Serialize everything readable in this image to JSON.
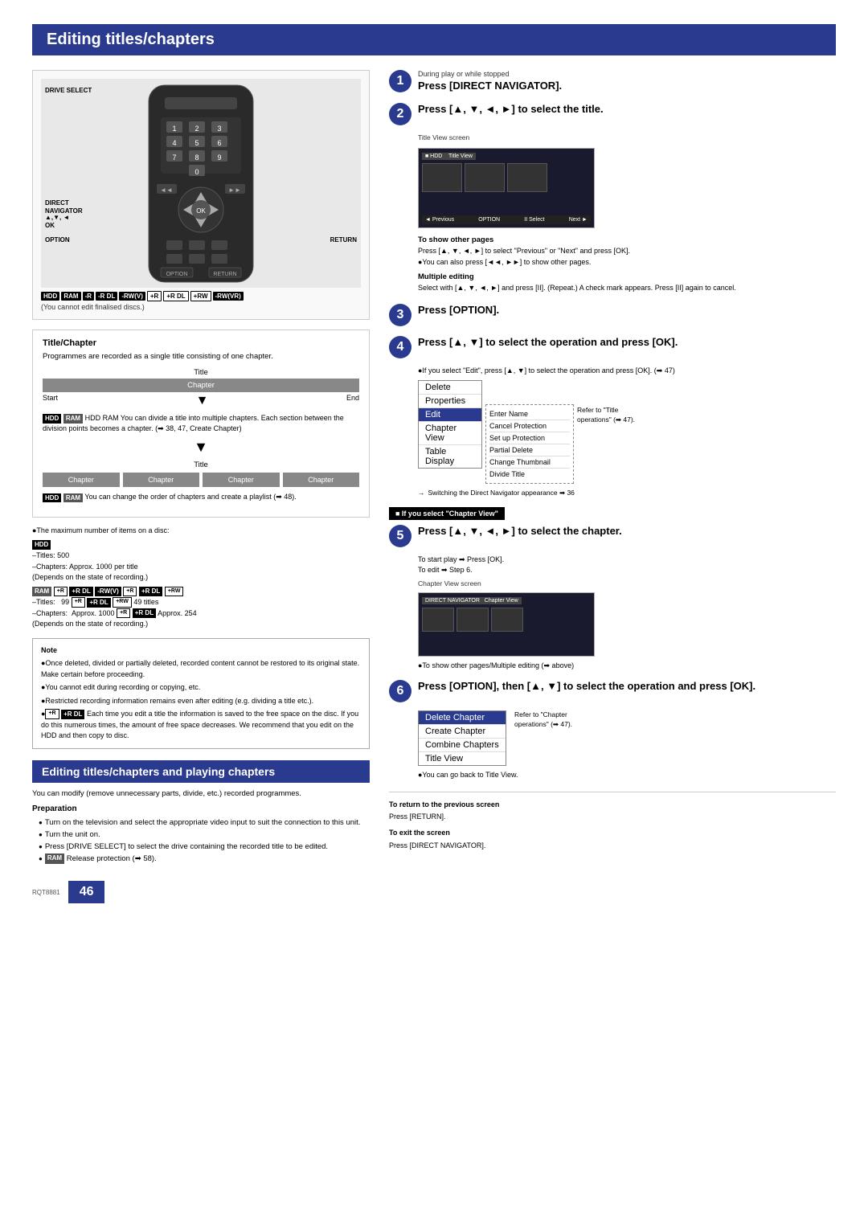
{
  "page": {
    "title": "Editing titles/chapters",
    "page_number": "46",
    "rqt_label": "RQT8881"
  },
  "left_col": {
    "remote_labels": {
      "drive_select": "DRIVE SELECT",
      "direct_navigator": "DIRECT\nNAVIGATOR",
      "arrows": "▲,▼, ◄\nOK",
      "option": "OPTION",
      "return": "RETURN"
    },
    "disc_badges": [
      "HDD",
      "RAM",
      "-R",
      "-R DL",
      "-RW(V)",
      "+R",
      "+R DL",
      "+RW",
      "-RW(VR)"
    ],
    "cant_edit": "(You cannot edit finalised discs.)",
    "title_chapter_section": {
      "title": "Title/Chapter",
      "desc": "Programmes are recorded as a single title consisting of one chapter.",
      "diagram": {
        "title_label": "Title",
        "chapter_label": "Chapter",
        "start_label": "Start",
        "end_label": "End",
        "hdd_ram_note": "HDD RAM You can divide a title into multiple chapters. Each section between the division points becomes a chapter. (➡ 38, 47, Create Chapter)"
      },
      "chapters_diagram": {
        "title_label": "Title",
        "chapters": [
          "Chapter",
          "Chapter",
          "Chapter",
          "Chapter"
        ],
        "hdd_ram_note": "HDD RAM You can change the order of chapters and create a playlist (➡ 48)."
      }
    },
    "max_items": {
      "intro": "●The maximum number of items on a disc:",
      "hdd_label": "HDD",
      "hdd_titles": "–Titles:   500",
      "hdd_chapters": "–Chapters:  Approx. 1000 per title",
      "hdd_depends": "(Depends on the state of recording.)",
      "ram_label": "RAM +R  +R DL  -RW(V)  +R  +R DL  +RW",
      "ram_titles": "–Titles:   99 +R +R DL +RW 49 titles",
      "ram_chapters": "–Chapters:  Approx. 1000 +R +R DL Approx. 254",
      "ram_depends": "(Depends on the state of recording.)"
    },
    "note": {
      "label": "Note",
      "items": [
        "Once deleted, divided or partially deleted, recorded content cannot be restored to its original state. Make certain before proceeding.",
        "You cannot edit during recording or copying, etc.",
        "Restricted recording information remains even after editing (e.g. dividing a title etc.).",
        "+R +R DL Each time you edit a title the information is saved to the free space on the disc. If you do this numerous times, the amount of free space decreases. We recommend that you edit on the HDD and then copy to disc."
      ]
    }
  },
  "editing_playing": {
    "title": "Editing titles/chapters and playing chapters",
    "desc": "You can modify (remove unnecessary parts, divide, etc.) recorded programmes.",
    "preparation": {
      "label": "Preparation",
      "items": [
        "Turn on the television and select the appropriate video input to suit the connection to this unit.",
        "Turn the unit on.",
        "Press [DRIVE SELECT] to select the drive containing the recorded title to be edited.",
        "RAM Release protection (➡ 58)."
      ]
    }
  },
  "right_col": {
    "steps": [
      {
        "number": "1",
        "sub": "During play or while stopped",
        "heading": "Press [DIRECT NAVIGATOR]."
      },
      {
        "number": "2",
        "heading": "Press [▲, ▼, ◄, ►] to select the title.",
        "screen_label": "Title View screen",
        "screen_note": "Title View screen",
        "to_show_pages_label": "To show other pages",
        "to_show_desc": "Press [▲, ▼, ◄, ►] to select \"Previous\" or \"Next\" and press [OK].",
        "also_press": "●You can also press [◄◄, ►►] to show other pages.",
        "multiple_editing_label": "Multiple editing",
        "multiple_editing_desc": "Select with [▲, ▼, ◄, ►] and press [II]. (Repeat.) A check mark appears. Press [II] again to cancel."
      },
      {
        "number": "3",
        "heading": "Press [OPTION]."
      },
      {
        "number": "4",
        "heading": "Press [▲, ▼] to select the operation and press [OK].",
        "bullet": "●If you select \"Edit\", press [▲, ▼] to select the operation and press [OK]. (➡ 47)",
        "menu_items": [
          "Enter Name",
          "Cancel Protection",
          "Set up Protection",
          "Partial Delete",
          "Change Thumbnail",
          "Divide Title"
        ],
        "menu_left": [
          "Delete",
          "Properties",
          "Edit"
        ],
        "menu_bottom": [
          "Chapter View",
          "Table Display"
        ],
        "refer_text": "Refer to \"Title operations\" (➡ 47).",
        "switching_text": "Switching the Direct Navigator appearance ➡ 36"
      },
      {
        "number": "5",
        "if_select_label": "■ If you select \"Chapter View\"",
        "heading": "Press [▲, ▼, ◄, ►] to select the chapter.",
        "to_start_play": "To start play ➡ Press [OK].",
        "to_edit": "To edit ➡ Step 6.",
        "screen_label": "Chapter View screen",
        "show_other": "●To show other pages/Multiple editing (➡ above)"
      },
      {
        "number": "6",
        "heading": "Press [OPTION], then [▲, ▼] to select the operation and press [OK].",
        "chapter_menu_items": [
          "Delete Chapter",
          "Create Chapter",
          "Combine Chapters",
          "Title View"
        ],
        "refer_text": "Refer to \"Chapter operations\" (➡ 47).",
        "go_back": "●You can go back to Title View."
      }
    ],
    "bottom_nav": {
      "return_label": "To return to the previous screen",
      "return_action": "Press [RETURN].",
      "exit_label": "To exit the screen",
      "exit_action": "Press [DIRECT NAVIGATOR]."
    }
  }
}
